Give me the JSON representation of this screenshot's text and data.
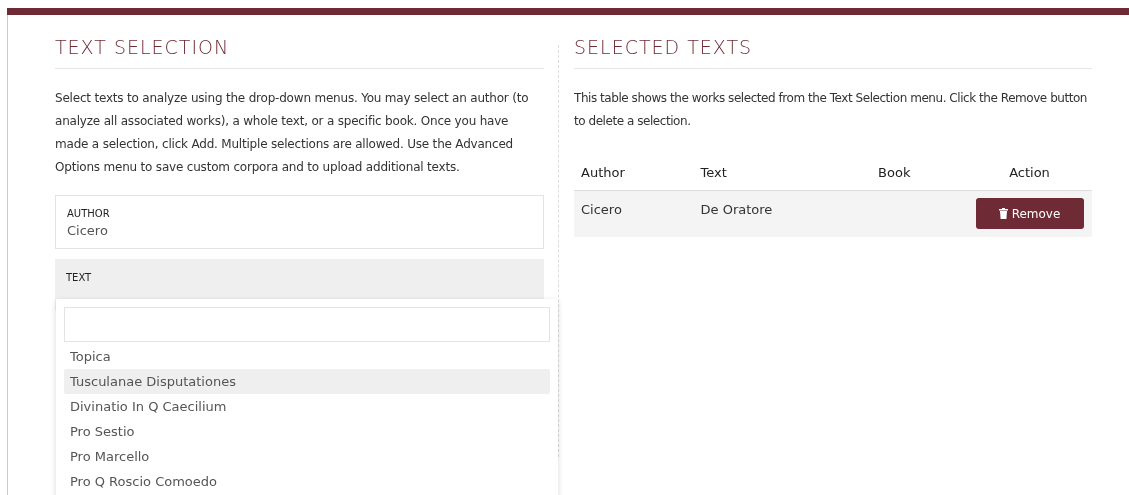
{
  "text_selection": {
    "title": "TEXT SELECTION",
    "description": "Select texts to analyze using the drop-down menus. You may select an author (to analyze all associated works), a whole text, or a specific book. Once you have made a selection, click Add. Multiple selections are allowed. Use the Advanced Options menu to save custom corpora and to upload additional texts.",
    "author_field": {
      "label": "AUTHOR",
      "value": "Cicero"
    },
    "text_field": {
      "label": "TEXT",
      "expanded": true
    },
    "dropdown_options": [
      {
        "label": "Topica",
        "selected": false
      },
      {
        "label": "Tusculanae Disputationes",
        "selected": true
      },
      {
        "label": "Divinatio In Q Caecilium",
        "selected": false
      },
      {
        "label": "Pro Sestio",
        "selected": false
      },
      {
        "label": "Pro Marcello",
        "selected": false
      },
      {
        "label": "Pro Q Roscio Comoedo",
        "selected": false
      }
    ]
  },
  "selected_texts": {
    "title": "SELECTED TEXTS",
    "description": "This table shows the works selected from the Text Selection menu. Click the Remove button to delete a selection.",
    "columns": [
      "Author",
      "Text",
      "Book",
      "Action"
    ],
    "rows": [
      {
        "author": "Cicero",
        "text": "De Oratore",
        "action": "Remove"
      }
    ]
  }
}
